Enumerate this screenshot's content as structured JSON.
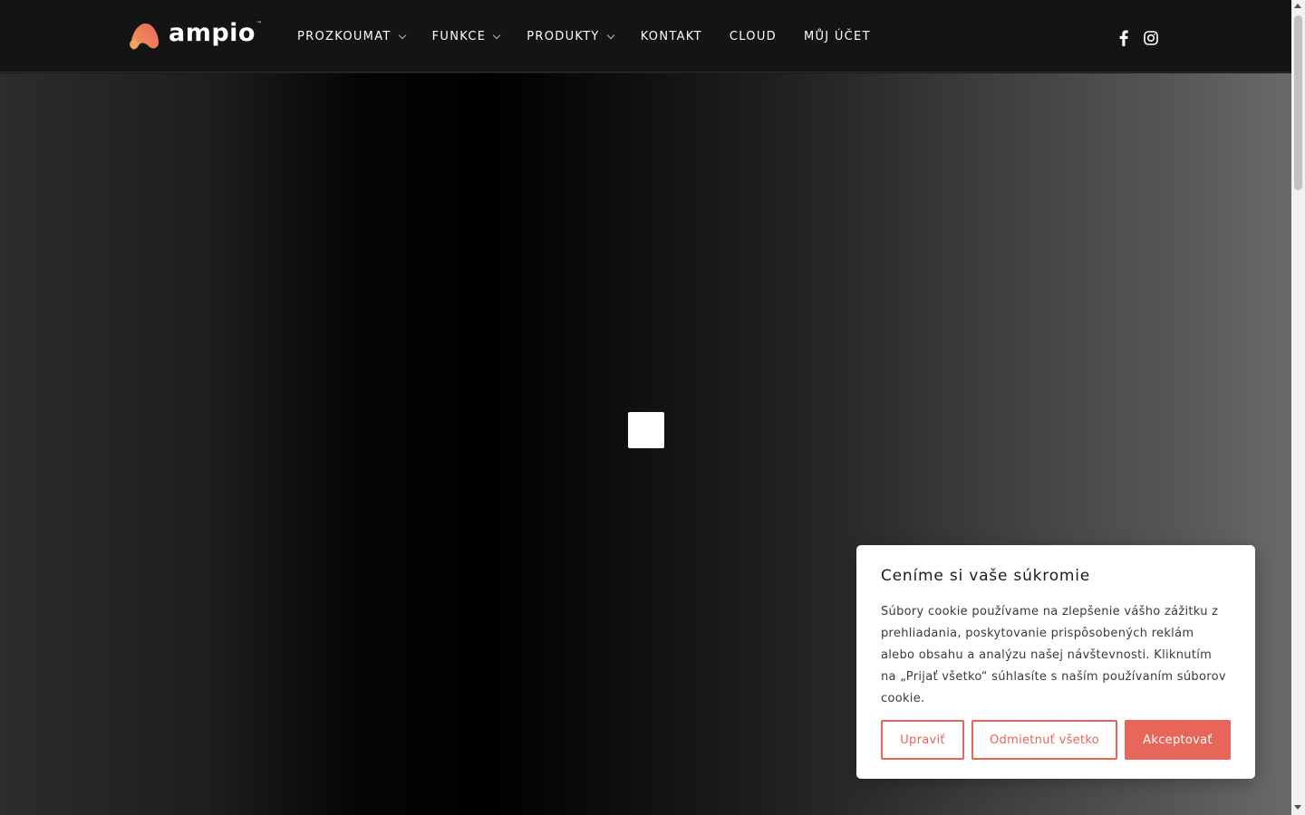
{
  "brand": {
    "logo_text": "ampio",
    "trademark": "™",
    "accent_color": "#e8655a"
  },
  "nav": {
    "items": [
      {
        "label": "PROZKOUMAT",
        "has_dropdown": true
      },
      {
        "label": "FUNKCE",
        "has_dropdown": true
      },
      {
        "label": "PRODUKTY",
        "has_dropdown": true
      },
      {
        "label": "KONTAKT",
        "has_dropdown": false
      },
      {
        "label": "CLOUD",
        "has_dropdown": false
      },
      {
        "label": "MŮJ ÚČET",
        "has_dropdown": false
      }
    ]
  },
  "social": {
    "icons": [
      "facebook-icon",
      "instagram-icon"
    ]
  },
  "hero": {
    "play_icon": "play-icon"
  },
  "cookie": {
    "title": "Ceníme si vaše súkromie",
    "text": "Súbory cookie používame na zlepšenie vášho zážitku z prehliadania, poskytovanie prispôsobených reklám alebo obsahu a analýzu našej návštevnosti. Kliknutím na „Prijať všetko“ súhlasíte s naším používaním súborov cookie.",
    "btn_customize": "Upraviť",
    "btn_reject": "Odmietnuť všetko",
    "btn_accept": "Akceptovať"
  }
}
